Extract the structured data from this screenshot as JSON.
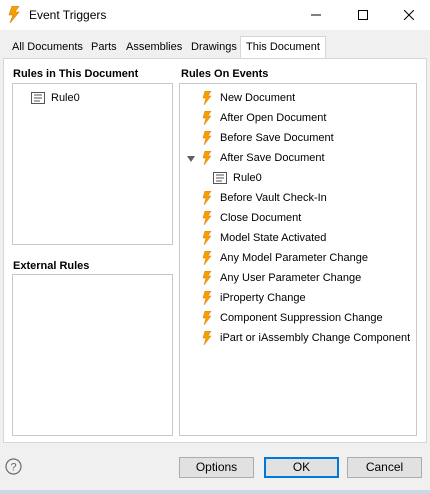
{
  "window": {
    "title": "Event Triggers",
    "accent": "#0078d7",
    "icon": "lightning-bolt-icon"
  },
  "tabs": [
    {
      "label": "All Documents",
      "active": false
    },
    {
      "label": "Parts",
      "active": false
    },
    {
      "label": "Assemblies",
      "active": false
    },
    {
      "label": "Drawings",
      "active": false
    },
    {
      "label": "This Document",
      "active": true
    }
  ],
  "rules_in_document": {
    "heading": "Rules in This Document",
    "items": [
      {
        "label": "Rule0",
        "icon": "rule-icon"
      }
    ]
  },
  "external_rules": {
    "heading": "External Rules",
    "items": []
  },
  "rules_on_events": {
    "heading": "Rules On Events",
    "events": [
      {
        "label": "New Document",
        "icon": "lightning-bolt-icon"
      },
      {
        "label": "After Open Document",
        "icon": "lightning-bolt-icon"
      },
      {
        "label": "Before Save Document",
        "icon": "lightning-bolt-icon"
      },
      {
        "label": "After Save Document",
        "icon": "lightning-bolt-icon",
        "expanded": true,
        "children": [
          {
            "label": "Rule0",
            "icon": "rule-icon"
          }
        ]
      },
      {
        "label": "Before Vault Check-In",
        "icon": "lightning-bolt-icon"
      },
      {
        "label": "Close Document",
        "icon": "lightning-bolt-icon"
      },
      {
        "label": "Model State Activated",
        "icon": "lightning-bolt-icon"
      },
      {
        "label": "Any Model Parameter Change",
        "icon": "lightning-bolt-icon"
      },
      {
        "label": "Any User Parameter Change",
        "icon": "lightning-bolt-icon"
      },
      {
        "label": "iProperty Change",
        "icon": "lightning-bolt-icon"
      },
      {
        "label": "Component Suppression Change",
        "icon": "lightning-bolt-icon"
      },
      {
        "label": "iPart or iAssembly Change Component",
        "icon": "lightning-bolt-icon"
      }
    ]
  },
  "buttons": {
    "options": "Options",
    "ok": "OK",
    "cancel": "Cancel"
  },
  "colors": {
    "bolt": "#f5a000",
    "bolt_dark": "#d97a00"
  }
}
